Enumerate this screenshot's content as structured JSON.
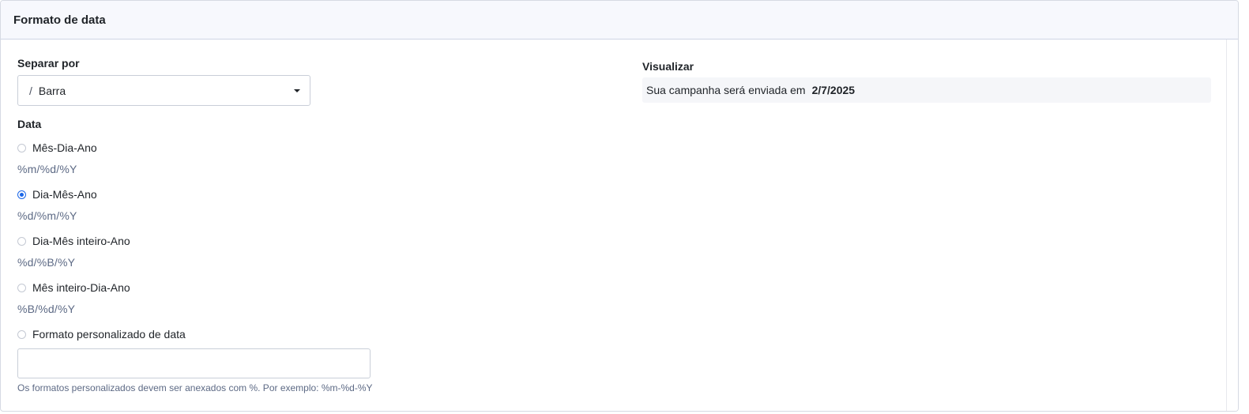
{
  "header": {
    "title": "Formato de data"
  },
  "separator": {
    "label": "Separar por",
    "selected_glyph": "/",
    "selected_label": "Barra"
  },
  "date": {
    "label": "Data",
    "options": [
      {
        "label": "Mês-Dia-Ano",
        "code": "%m/%d/%Y",
        "checked": false
      },
      {
        "label": "Dia-Mês-Ano",
        "code": "%d/%m/%Y",
        "checked": true
      },
      {
        "label": "Dia-Mês inteiro-Ano",
        "code": "%d/%B/%Y",
        "checked": false
      },
      {
        "label": "Mês inteiro-Dia-Ano",
        "code": "%B/%d/%Y",
        "checked": false
      },
      {
        "label": "Formato personalizado de data",
        "code": "",
        "checked": false
      }
    ],
    "custom_value": "",
    "hint": "Os formatos personalizados devem ser anexados com %. Por exemplo: %m-%d-%Y"
  },
  "preview": {
    "label": "Visualizar",
    "text": "Sua campanha será enviada em",
    "date": "2/7/2025"
  },
  "colors": {
    "accent": "#1a66e8",
    "code_text": "#5d6a85",
    "header_bg": "#f7f8fd"
  }
}
